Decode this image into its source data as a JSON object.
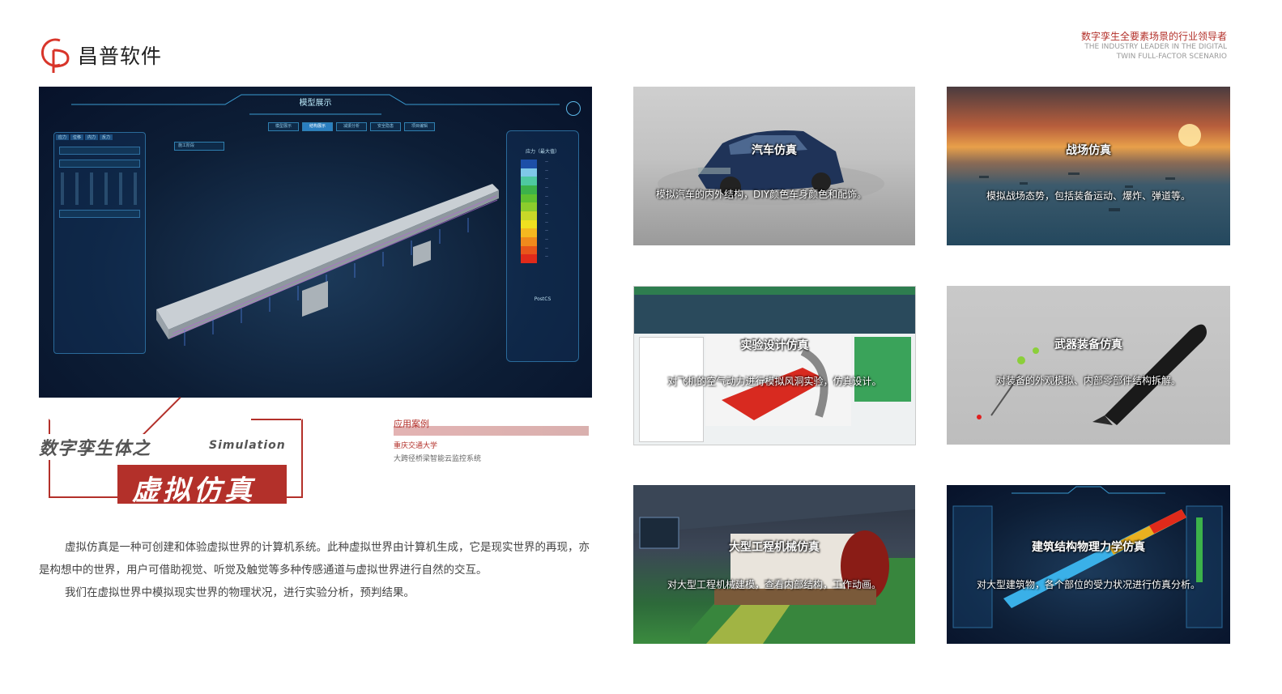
{
  "brand": {
    "name": "昌普软件",
    "tagline_cn": "数字孪生全要素场景的行业领导者",
    "tagline_en_line1": "THE INDUSTRY LEADER IN THE DIGITAL",
    "tagline_en_line2": "TWIN FULL-FACTOR SCENARIO",
    "accent_color": "#b3302a"
  },
  "hero": {
    "title": "模型展示",
    "tabs": [
      "模型展示",
      "结构展示",
      "减振分析",
      "安全隐患",
      "项目编辑"
    ],
    "active_tab": 1,
    "left_tabs": [
      "应力",
      "位移",
      "内力",
      "反力"
    ],
    "dropdown": "施工阶段",
    "legend_title": "应力（最大值）",
    "legend_footer": "PostCS",
    "legend_colors": [
      "#1d4fa8",
      "#7fc8e8",
      "#4ec9a0",
      "#3cb24a",
      "#5fc030",
      "#8ccc2c",
      "#c8d828",
      "#f0e020",
      "#f5b820",
      "#f08a1c",
      "#e8551a",
      "#e02a1a"
    ]
  },
  "section": {
    "title_part1": "数字孪生体之",
    "title_en": "Simulation",
    "title_part2": "虚拟仿真"
  },
  "case": {
    "label": "应用案例",
    "organization": "重庆交通大学",
    "project": "大跨径桥梁智能云监控系统"
  },
  "description": [
    "虚拟仿真是一种可创建和体验虚拟世界的计算机系统。此种虚拟世界由计算机生成，它是现实世界的再现，亦是构想中的世界，用户可借助视觉、听觉及触觉等多种传感通道与虚拟世界进行自然的交互。",
    "我们在虚拟世界中模拟现实世界的物理状况，进行实验分析，预判结果。"
  ],
  "cards": [
    {
      "title": "汽车仿真",
      "desc": "模拟汽车的内外结构，DIY颜色车身颜色和配饰。"
    },
    {
      "title": "战场仿真",
      "desc": "模拟战场态势，包括装备运动、爆炸、弹道等。"
    },
    {
      "title": "实验设计仿真",
      "desc": "对飞机的空气动力进行模拟风洞实验，仿真设计。"
    },
    {
      "title": "武器装备仿真",
      "desc": "对装备的外观模拟、内部零部件结构拆解。"
    },
    {
      "title": "大型工程机械仿真",
      "desc": "对大型工程机械建模，查看内部结构，工作动画。"
    },
    {
      "title": "建筑结构物理力学仿真",
      "desc": "对大型建筑物，各个部位的受力状况进行仿真分析。"
    }
  ]
}
